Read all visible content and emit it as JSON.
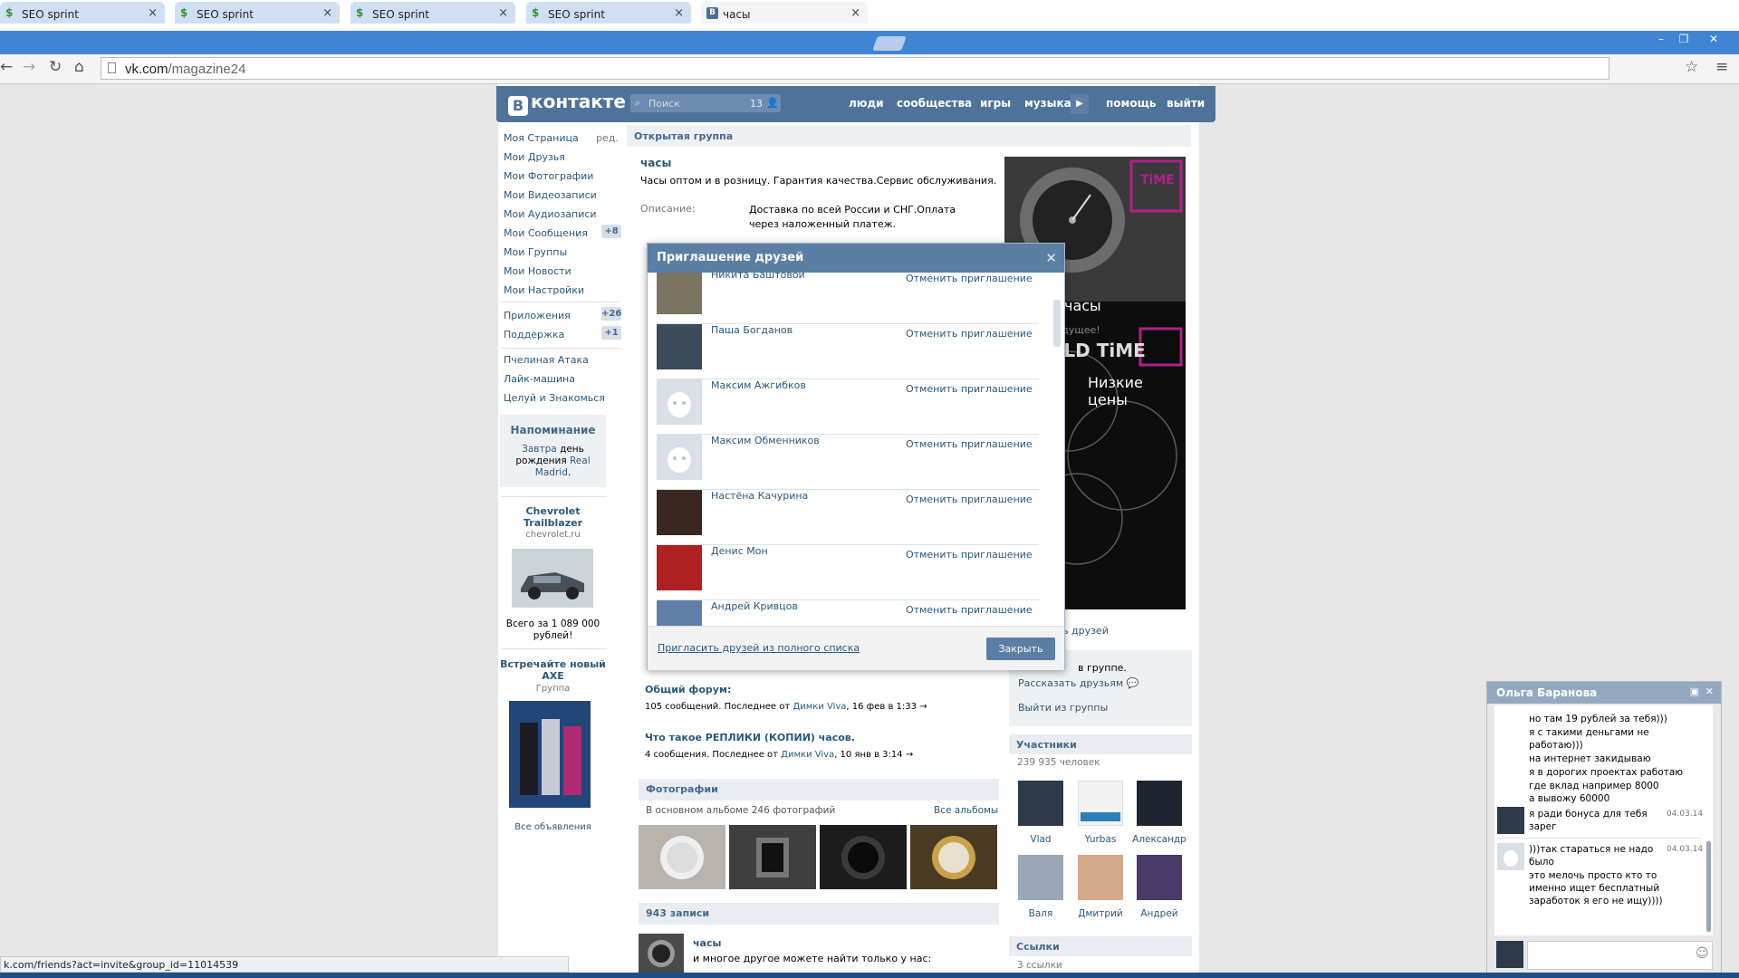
{
  "browser": {
    "tabs": [
      {
        "label": "SEO sprint",
        "icon": "seosprint-favicon-icon",
        "active": false
      },
      {
        "label": "SEO sprint",
        "icon": "seosprint-favicon-icon",
        "active": false
      },
      {
        "label": "SEO sprint",
        "icon": "seosprint-favicon-icon",
        "active": false
      },
      {
        "label": "SEO sprint",
        "icon": "seosprint-favicon-icon",
        "active": false
      },
      {
        "label": "часы",
        "icon": "vk-favicon-icon",
        "active": true
      }
    ],
    "tab_close": "×",
    "url_host": "vk.com",
    "url_path": "/magazine24",
    "status_url": "k.com/friends?act=invite&group_id=11014539"
  },
  "vk": {
    "logo": "контакте",
    "logo_letter": "В",
    "search_placeholder": "Поиск",
    "search_count": "13",
    "nav": [
      "люди",
      "сообщества",
      "игры",
      "музыка",
      "помощь",
      "выйти"
    ],
    "left_menu": [
      {
        "label": "Моя Страница",
        "extra": "ред."
      },
      {
        "label": "Мои Друзья"
      },
      {
        "label": "Мои Фотографии"
      },
      {
        "label": "Мои Видеозаписи"
      },
      {
        "label": "Мои Аудиозаписи"
      },
      {
        "label": "Мои Сообщения",
        "count": "+8"
      },
      {
        "label": "Мои Группы"
      },
      {
        "label": "Мои Новости"
      },
      {
        "label": "Мои Настройки"
      },
      {
        "label": "Приложения",
        "count": "+26"
      },
      {
        "label": "Поддержка",
        "count": "+1"
      },
      {
        "label": "Пчелиная Атака"
      },
      {
        "label": "Лайк-машина"
      },
      {
        "label": "Целуй и Знакомься"
      }
    ],
    "reminder": {
      "title": "Напоминание",
      "text1": "Завтра",
      "text2": "день рождения",
      "link": "Real Madrid",
      "end": "."
    },
    "ad1": {
      "title": "Chevrolet Trailblazer",
      "domain": "chevrolet.ru",
      "text": "Всего за 1 089 000 рублей!"
    },
    "ad2": {
      "title": "Встречайте новый AXE",
      "sub": "Группа"
    },
    "all_ads": "Все объявления"
  },
  "group": {
    "type": "Открытая группа",
    "name": "часы",
    "status": "Часы оптом и в розницу. Гарантия качества.Сервис обслуживания.",
    "desc_label": "Описание:",
    "desc_text": "Доставка по всей России и СНГ.Оплата через наложенный платеж.",
    "forum": [
      {
        "title": "Общий форум:",
        "meta_prefix": "105 сообщений. Последнее от",
        "author": "Димки Viva",
        "date": ", 16 фев в 1:33",
        "arrow": "→"
      },
      {
        "title": "Что такое РЕПЛИКИ (КОПИИ) часов.",
        "meta_prefix": "4 сообщения. Последнее от",
        "author": "Димки Viva",
        "date": ", 10 янв в 3:14",
        "arrow": "→"
      }
    ],
    "photos_header": "Фотографии",
    "photos_sub": "В основном альбоме 246 фотографий",
    "photos_all": "Все альбомы",
    "posts_header": "943 записи",
    "post_author": "часы",
    "post_text": "и многое другое можете найти только у нас:",
    "banner_text1": "часы",
    "banner_text2": "Низкие цены",
    "banner_brand": "TiME",
    "banner_world": "RLD TiME",
    "banner_future": "будущее!",
    "right_links": {
      "invite_friends": "ь друзей",
      "in_group": "в группе.",
      "tell_friends": "Рассказать друзьям",
      "leave": "Выйти из группы"
    },
    "members_header": "Участники",
    "members_count": "239 935 человек",
    "members": [
      "Vlad",
      "Yurbas",
      "Александр",
      "Валя",
      "Дмитрий",
      "Андрей"
    ],
    "links_header": "Ссылки",
    "links_count": "3 ссылки"
  },
  "modal": {
    "title": "Приглашение друзей",
    "cancel_label": "Отменить приглашение",
    "friends": [
      "Никита Баштовой",
      "Паша Богданов",
      "Максим Ажгибков",
      "Максим Обменников",
      "Настёна Качурина",
      "Денис Мон",
      "Андрей Кривцов"
    ],
    "invite_full": "Пригласить друзей из полного списка",
    "close_button": "Закрыть"
  },
  "chat": {
    "title": "Ольга Баранова",
    "lines_top": [
      "но там 19 рублей за тебя)))",
      "я с такими деньгами не работаю)))",
      "на интернет закидываю",
      "я в дорогих проектах работаю",
      "где вклад например 8000 а вывожу 60000"
    ],
    "msg2": "я ради бонуса для тебя зарег",
    "msg2_date": "04.03.14",
    "msg3a": ")))так стараться не надо было",
    "msg3b": "это мелочь просто кто то именно ищет бесплатный заработок я его не ищу))))",
    "msg3_date": "04.03.14"
  },
  "colors": {
    "vk_blue": "#4e729a",
    "link": "#2b587a",
    "chrome_blue": "#3f85d4"
  }
}
